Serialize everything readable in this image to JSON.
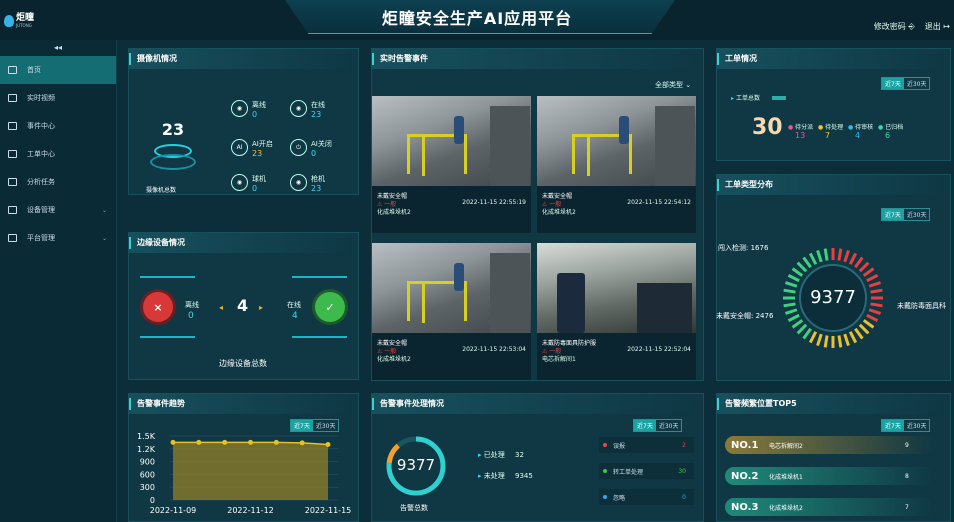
{
  "app": {
    "title": "炬瞳安全生产AI应用平台",
    "logo_cn": "炬瞳",
    "logo_en": "JUTONG",
    "change_password": "修改密码",
    "logout": "退出"
  },
  "sidebar": {
    "collapse": "◂◂",
    "items": [
      {
        "label": "首页",
        "icon": "home-icon",
        "active": true,
        "expand": false
      },
      {
        "label": "实时视频",
        "icon": "camera-icon",
        "active": false,
        "expand": false
      },
      {
        "label": "事件中心",
        "icon": "monitor-icon",
        "active": false,
        "expand": false
      },
      {
        "label": "工单中心",
        "icon": "document-icon",
        "active": false,
        "expand": false
      },
      {
        "label": "分析任务",
        "icon": "calendar-icon",
        "active": false,
        "expand": false
      },
      {
        "label": "设备管理",
        "icon": "device-icon",
        "active": false,
        "expand": true
      },
      {
        "label": "平台管理",
        "icon": "platform-icon",
        "active": false,
        "expand": true
      }
    ]
  },
  "camera": {
    "title": "摄像机情况",
    "total": "23",
    "total_label": "摄像机总数",
    "stats": [
      {
        "label": "离线",
        "value": "0",
        "color": "cyan",
        "icon": "camera-icon"
      },
      {
        "label": "在线",
        "value": "23",
        "color": "cyan",
        "icon": "camera-icon"
      },
      {
        "label": "AI开启",
        "value": "23",
        "color": "yellow",
        "icon": "ai-icon"
      },
      {
        "label": "AI关闭",
        "value": "0",
        "color": "cyan",
        "icon": "power-icon"
      },
      {
        "label": "球机",
        "value": "0",
        "color": "cyan",
        "icon": "dome-camera-icon"
      },
      {
        "label": "枪机",
        "value": "23",
        "color": "cyan",
        "icon": "bullet-camera-icon"
      }
    ]
  },
  "edge": {
    "title": "边缘设备情况",
    "offline_label": "离线",
    "offline": "0",
    "total": "4",
    "online_label": "在线",
    "online": "4",
    "total_label": "边缘设备总数"
  },
  "trend": {
    "title": "告警事件趋势",
    "toggle": [
      "近7天",
      "近30天"
    ]
  },
  "alarms": {
    "title": "实时告警事件",
    "filter": "全部类型",
    "items": [
      {
        "name": "未戴安全帽",
        "level": "一般",
        "device": "化成堆垛机2",
        "time": "2022-11-15 22:55:19"
      },
      {
        "name": "未戴安全帽",
        "level": "一般",
        "device": "化成堆垛机2",
        "time": "2022-11-15 22:54:12"
      },
      {
        "name": "未戴安全帽",
        "level": "一般",
        "device": "化成堆垛机2",
        "time": "2022-11-15 22:53:04"
      },
      {
        "name": "未戴防毒面具防护服",
        "level": "一般",
        "device": "电芯拆解间1",
        "time": "2022-11-15 22:52:04"
      }
    ]
  },
  "processing": {
    "title": "告警事件处理情况",
    "total": "9377",
    "total_label": "告警总数",
    "processed_label": "已处理",
    "processed": "32",
    "unprocessed_label": "未处理",
    "unprocessed": "9345",
    "toggle": [
      "近7天",
      "近30天"
    ],
    "rows": [
      {
        "label": "误报",
        "value": "2",
        "color": "#e84848"
      },
      {
        "label": "转工单处理",
        "value": "30",
        "color": "#3cc84c"
      },
      {
        "label": "忽略",
        "value": "0",
        "color": "#3aa8e8"
      }
    ]
  },
  "orders": {
    "title": "工单情况",
    "total_label": "工单总数",
    "total": "30",
    "toggle": [
      "近7天",
      "近30天"
    ],
    "stats": [
      {
        "label": "待分派",
        "value": "13",
        "color": "#e85898"
      },
      {
        "label": "待处理",
        "value": "7",
        "color": "#e8c830"
      },
      {
        "label": "待审核",
        "value": "4",
        "color": "#3ab8e8"
      },
      {
        "label": "已归档",
        "value": "6",
        "color": "#3ad8a8"
      }
    ]
  },
  "order_types": {
    "title": "工单类型分布",
    "total": "9377",
    "toggle": [
      "近7天",
      "近30天"
    ],
    "labels": {
      "left_top": "闯入检测: 1676",
      "left_bottom": "未戴安全帽: 2476",
      "right": "未戴防毒面具科"
    }
  },
  "tops": {
    "title": "告警频繁位置TOP5",
    "toggle": [
      "近7天",
      "近30天"
    ],
    "rows": [
      {
        "no": "NO.1",
        "name": "电芯拆解间2",
        "count": "9",
        "bg": "#8a7a3a"
      },
      {
        "no": "NO.2",
        "name": "化成堆垛机1",
        "count": "8",
        "bg": "#1f8a7a"
      },
      {
        "no": "NO.3",
        "name": "化成堆垛机2",
        "count": "7",
        "bg": "#1f8a7a"
      }
    ]
  },
  "chart_data": {
    "type": "area",
    "x": [
      "2022-11-09",
      "2022-11-10",
      "2022-11-11",
      "2022-11-12",
      "2022-11-13",
      "2022-11-14",
      "2022-11-15"
    ],
    "values": [
      1350,
      1350,
      1350,
      1350,
      1350,
      1340,
      1300
    ],
    "xticks": [
      "2022-11-09",
      "2022-11-12",
      "2022-11-15"
    ],
    "yticks": [
      "0",
      "300",
      "600",
      "900",
      "1.2K",
      "1.5K"
    ],
    "ylim": [
      0,
      1500
    ],
    "grid": true,
    "series_color": "#e8c020"
  }
}
